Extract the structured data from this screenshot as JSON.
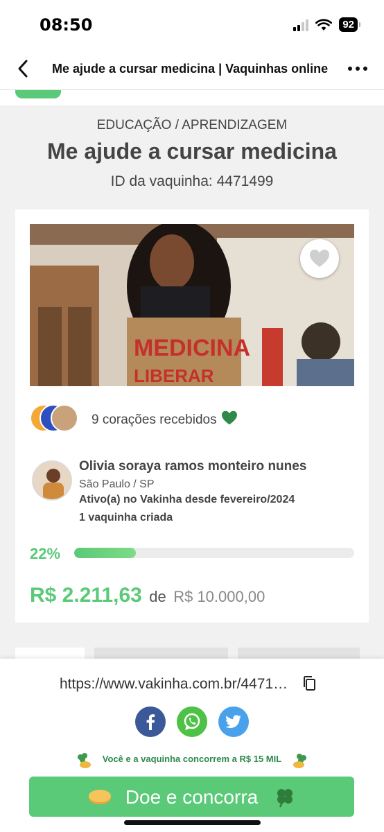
{
  "status_bar": {
    "time": "08:50",
    "battery": "92"
  },
  "browser": {
    "title": "Me ajude a cursar medicina | Vaquinhas online"
  },
  "campaign": {
    "category": "EDUCAÇÃO / APRENDIZAGEM",
    "title": "Me ajude a cursar medicina",
    "id_label": "ID da vaquinha: 4471499"
  },
  "hero": {
    "sign_text": "MEDICINA",
    "sign_text_2": "LIBERAR"
  },
  "hearts": {
    "text": "9 corações recebidos"
  },
  "owner": {
    "name": "Olivia soraya ramos monteiro nunes",
    "location": "São Paulo /  SP",
    "since": "Ativo(a) no Vakinha desde fevereiro/2024",
    "count": "1 vaquinha criada"
  },
  "progress": {
    "percent_label": "22%",
    "fraction": 0.22
  },
  "amounts": {
    "raised": "R$ 2.211,63",
    "de": "de",
    "goal": "R$ 10.000,00"
  },
  "share": {
    "url": "https://www.vakinha.com.br/4471499",
    "promo": "Você e a vaquinha concorrem a R$ 15 MIL",
    "donate": "Doe e concorra"
  },
  "colors": {
    "brand_green": "#5ac978",
    "facebook": "#3b5998",
    "whatsapp": "#4dc247",
    "twitter": "#4aa1eb"
  }
}
